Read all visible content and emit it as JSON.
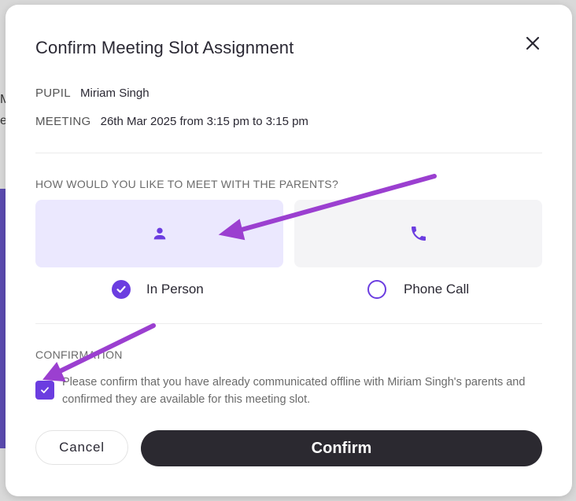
{
  "dialog": {
    "title": "Confirm Meeting Slot Assignment",
    "close_icon": "close-icon"
  },
  "pupil": {
    "label": "PUPIL",
    "value": "Miriam Singh"
  },
  "meeting": {
    "label": "MEETING",
    "value": "26th Mar 2025 from 3:15 pm to 3:15 pm"
  },
  "method": {
    "question": "HOW WOULD YOU LIKE TO MEET WITH THE PARENTS?",
    "options": [
      {
        "label": "In Person",
        "icon": "person-icon",
        "selected": true
      },
      {
        "label": "Phone Call",
        "icon": "phone-icon",
        "selected": false
      }
    ]
  },
  "confirmation": {
    "label": "CONFIRMATION",
    "checked": true,
    "text": "Please confirm that you have already communicated offline with Miriam Singh's parents and confirmed they are available for this meeting slot."
  },
  "buttons": {
    "cancel": "Cancel",
    "confirm": "Confirm"
  },
  "colors": {
    "accent": "#6b3de0",
    "selected_card": "#ebe8fe",
    "unselected_card": "#f4f4f6",
    "primary_button": "#2b2930",
    "annotation_arrow": "#9b3fd0"
  },
  "background_fragments": [
    "M",
    "e"
  ]
}
